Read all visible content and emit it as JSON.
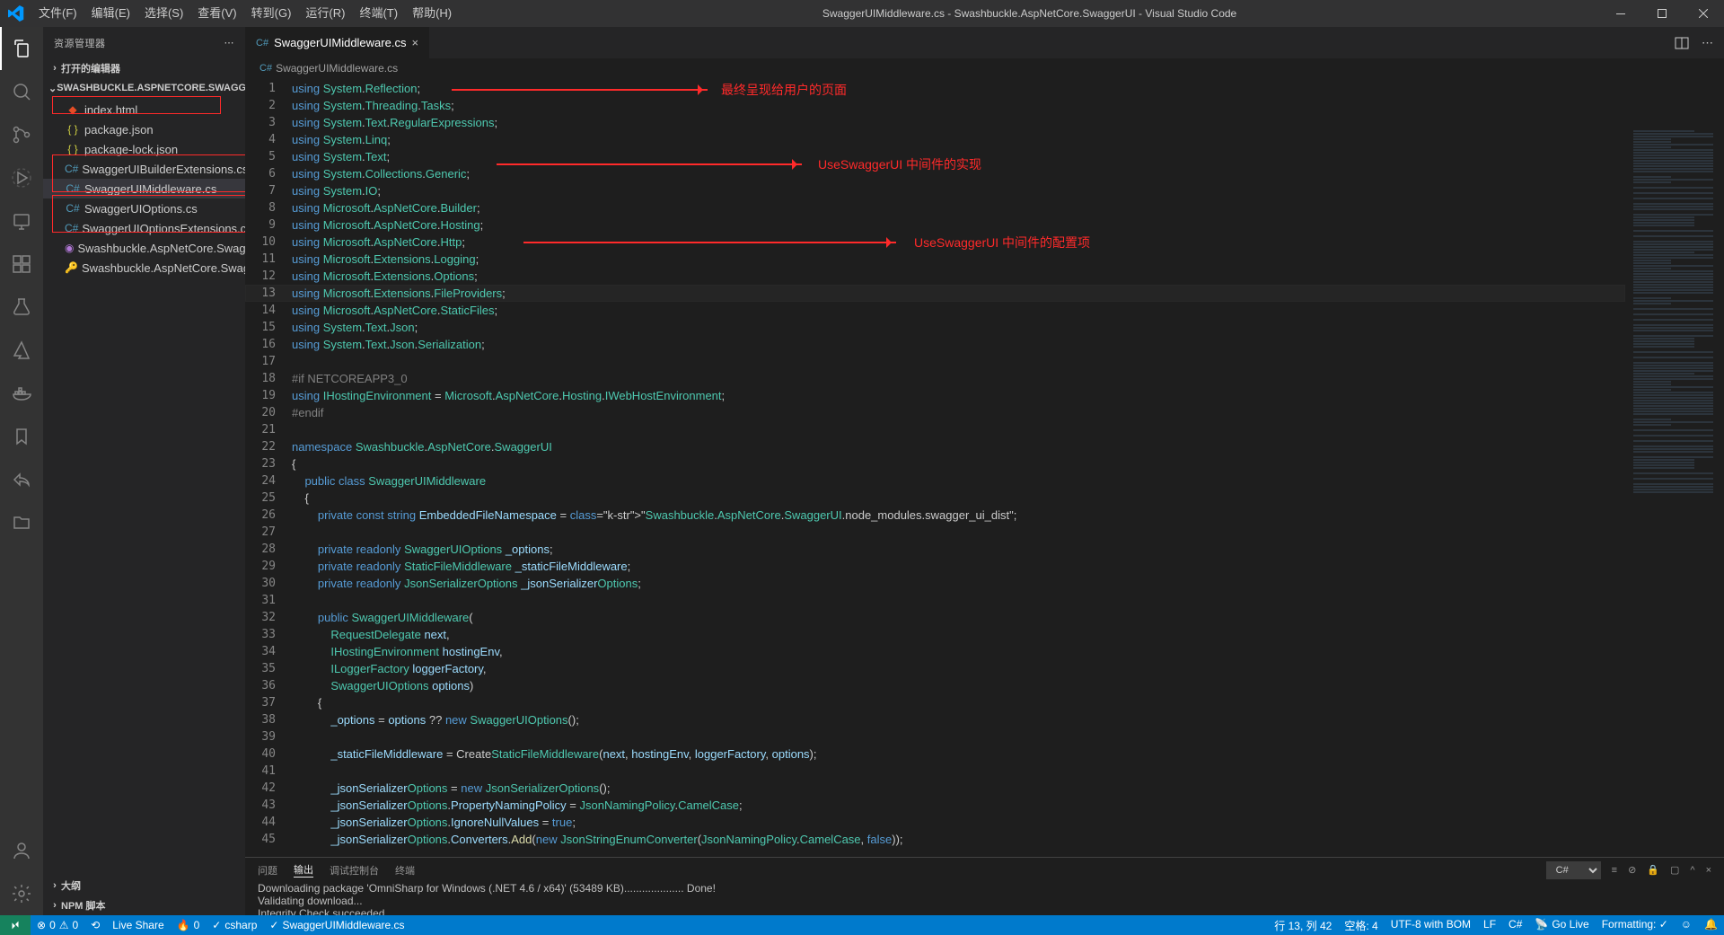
{
  "titlebar": {
    "menu": [
      "文件(F)",
      "编辑(E)",
      "选择(S)",
      "查看(V)",
      "转到(G)",
      "运行(R)",
      "终端(T)",
      "帮助(H)"
    ],
    "title": "SwaggerUIMiddleware.cs - Swashbuckle.AspNetCore.SwaggerUI - Visual Studio Code"
  },
  "sidebar": {
    "title": "资源管理器",
    "sections": {
      "open_editors": "打开的编辑器",
      "project": "SWASHBUCKLE.ASPNETCORE.SWAGGERUI",
      "outline": "大纲",
      "npm": "NPM 脚本"
    },
    "files": [
      {
        "name": "index.html",
        "icon": "html"
      },
      {
        "name": "package.json",
        "icon": "json"
      },
      {
        "name": "package-lock.json",
        "icon": "json"
      },
      {
        "name": "SwaggerUIBuilderExtensions.cs",
        "icon": "cs"
      },
      {
        "name": "SwaggerUIMiddleware.cs",
        "icon": "cs",
        "selected": true
      },
      {
        "name": "SwaggerUIOptions.cs",
        "icon": "cs"
      },
      {
        "name": "SwaggerUIOptionsExtensions.cs",
        "icon": "cs"
      },
      {
        "name": "Swashbuckle.AspNetCore.SwaggerUI.csp…",
        "icon": "sln"
      },
      {
        "name": "Swashbuckle.AspNetCore.SwaggerUI.snk",
        "icon": "snk"
      }
    ]
  },
  "tabs": {
    "active": "SwaggerUIMiddleware.cs",
    "breadcrumb": "SwaggerUIMiddleware.cs"
  },
  "annotations": {
    "a1": "最终呈现给用户的页面",
    "a2": "UseSwaggerUI 中间件的实现",
    "a3": "UseSwaggerUI 中间件的配置项"
  },
  "code": {
    "lines": [
      "using System.Reflection;",
      "using System.Threading.Tasks;",
      "using System.Text.RegularExpressions;",
      "using System.Linq;",
      "using System.Text;",
      "using System.Collections.Generic;",
      "using System.IO;",
      "using Microsoft.AspNetCore.Builder;",
      "using Microsoft.AspNetCore.Hosting;",
      "using Microsoft.AspNetCore.Http;",
      "using Microsoft.Extensions.Logging;",
      "using Microsoft.Extensions.Options;",
      "using Microsoft.Extensions.FileProviders;",
      "using Microsoft.AspNetCore.StaticFiles;",
      "using System.Text.Json;",
      "using System.Text.Json.Serialization;",
      "",
      "#if NETCOREAPP3_0",
      "using IHostingEnvironment = Microsoft.AspNetCore.Hosting.IWebHostEnvironment;",
      "#endif",
      "",
      "namespace Swashbuckle.AspNetCore.SwaggerUI",
      "{",
      "    public class SwaggerUIMiddleware",
      "    {",
      "        private const string EmbeddedFileNamespace = \"Swashbuckle.AspNetCore.SwaggerUI.node_modules.swagger_ui_dist\";",
      "",
      "        private readonly SwaggerUIOptions _options;",
      "        private readonly StaticFileMiddleware _staticFileMiddleware;",
      "        private readonly JsonSerializerOptions _jsonSerializerOptions;",
      "",
      "        public SwaggerUIMiddleware(",
      "            RequestDelegate next,",
      "            IHostingEnvironment hostingEnv,",
      "            ILoggerFactory loggerFactory,",
      "            SwaggerUIOptions options)",
      "        {",
      "            _options = options ?? new SwaggerUIOptions();",
      "",
      "            _staticFileMiddleware = CreateStaticFileMiddleware(next, hostingEnv, loggerFactory, options);",
      "",
      "            _jsonSerializerOptions = new JsonSerializerOptions();",
      "            _jsonSerializerOptions.PropertyNamingPolicy = JsonNamingPolicy.CamelCase;",
      "            _jsonSerializerOptions.IgnoreNullValues = true;",
      "            _jsonSerializerOptions.Converters.Add(new JsonStringEnumConverter(JsonNamingPolicy.CamelCase, false));"
    ]
  },
  "panel": {
    "tabs": [
      "问题",
      "输出",
      "调试控制台",
      "终端"
    ],
    "selector": "C#",
    "body": [
      "Downloading package 'OmniSharp for Windows (.NET 4.6 / x64)' (53489 KB).................... Done!",
      "Validating download...",
      "Integrity Check succeeded."
    ]
  },
  "status": {
    "errors": "0",
    "warnings": "0",
    "liveshare": "Live Share",
    "flame": "0",
    "csharp": "csharp",
    "file": "SwaggerUIMiddleware.cs",
    "lncol": "行 13, 列 42",
    "spaces": "空格: 4",
    "encoding": "UTF-8 with BOM",
    "eol": "LF",
    "lang": "C#",
    "golive": "Go Live",
    "formatting": "Formatting: ✓"
  }
}
